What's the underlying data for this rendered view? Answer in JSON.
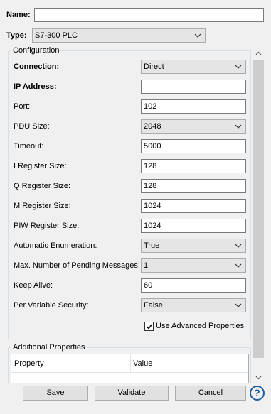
{
  "header": {
    "name_label": "Name:",
    "name_value": "",
    "type_label": "Type:",
    "type_value": "S7-300 PLC"
  },
  "configuration": {
    "title": "Configuration",
    "connection": {
      "label": "Connection:",
      "value": "Direct"
    },
    "ip_address": {
      "label": "IP Address:",
      "value": ""
    },
    "port": {
      "label": "Port:",
      "value": "102"
    },
    "pdu_size": {
      "label": "PDU Size:",
      "value": "2048"
    },
    "timeout": {
      "label": "Timeout:",
      "value": "5000"
    },
    "i_register": {
      "label": "I Register Size:",
      "value": "128"
    },
    "q_register": {
      "label": "Q Register Size:",
      "value": "128"
    },
    "m_register": {
      "label": "M Register Size:",
      "value": "1024"
    },
    "piw_register": {
      "label": "PIW Register Size:",
      "value": "1024"
    },
    "auto_enum": {
      "label": "Automatic Enumeration:",
      "value": "True"
    },
    "max_pending": {
      "label": "Max. Number of Pending Messages:",
      "value": "1"
    },
    "keep_alive": {
      "label": "Keep Alive:",
      "value": "60"
    },
    "per_var_security": {
      "label": "Per Variable Security:",
      "value": "False"
    },
    "advanced": {
      "label": "Use Advanced Properties",
      "checked": true
    }
  },
  "additional": {
    "title": "Additional Properties",
    "columns": [
      "Property",
      "Value"
    ]
  },
  "buttons": {
    "save": "Save",
    "validate": "Validate",
    "cancel": "Cancel",
    "help": "?"
  },
  "colors": {
    "accent": "#1f5e9c",
    "background": "#f0f0f0"
  }
}
